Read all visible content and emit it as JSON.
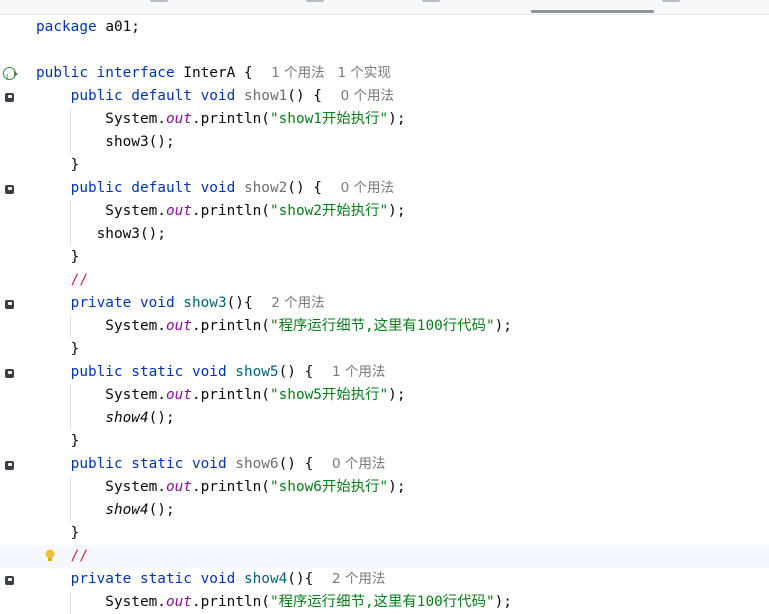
{
  "editor": {
    "lines": [
      {
        "tokens": [
          {
            "c": "kw",
            "t": "package"
          },
          {
            "c": "",
            "t": " a01;"
          }
        ]
      },
      {
        "tokens": []
      },
      {
        "gutter": "implemented",
        "tokens": [
          {
            "c": "kw",
            "t": "public interface"
          },
          {
            "c": "",
            "t": " InterA { "
          },
          {
            "c": "hint",
            "t": "1 个用法   1 个实现"
          }
        ]
      },
      {
        "gutter": "method",
        "tokens": [
          {
            "c": "",
            "t": "    "
          },
          {
            "c": "kw",
            "t": "public default void"
          },
          {
            "c": "",
            "t": " "
          },
          {
            "c": "fn-unused",
            "t": "show1"
          },
          {
            "c": "",
            "t": "() { "
          },
          {
            "c": "hint",
            "t": "0 个用法"
          }
        ]
      },
      {
        "tokens": [
          {
            "c": "",
            "t": "        System."
          },
          {
            "c": "field",
            "t": "out"
          },
          {
            "c": "",
            "t": ".println("
          },
          {
            "c": "str",
            "t": "\"show1开始执行\""
          },
          {
            "c": "",
            "t": ");"
          }
        ]
      },
      {
        "tokens": [
          {
            "c": "",
            "t": "        show3();"
          }
        ]
      },
      {
        "tokens": [
          {
            "c": "",
            "t": "    }"
          }
        ]
      },
      {
        "gutter": "method",
        "tokens": [
          {
            "c": "",
            "t": "    "
          },
          {
            "c": "kw",
            "t": "public default void"
          },
          {
            "c": "",
            "t": " "
          },
          {
            "c": "fn-unused",
            "t": "show2"
          },
          {
            "c": "",
            "t": "() { "
          },
          {
            "c": "hint",
            "t": "0 个用法"
          }
        ]
      },
      {
        "tokens": [
          {
            "c": "",
            "t": "        System."
          },
          {
            "c": "field",
            "t": "out"
          },
          {
            "c": "",
            "t": ".println("
          },
          {
            "c": "str",
            "t": "\"show2开始执行\""
          },
          {
            "c": "",
            "t": ");"
          }
        ]
      },
      {
        "tokens": [
          {
            "c": "",
            "t": "       show3();"
          }
        ]
      },
      {
        "tokens": [
          {
            "c": "",
            "t": "    }"
          }
        ]
      },
      {
        "tokens": [
          {
            "c": "",
            "t": "    "
          },
          {
            "c": "cmt-todo",
            "t": "//"
          }
        ]
      },
      {
        "gutter": "method",
        "tokens": [
          {
            "c": "",
            "t": "    "
          },
          {
            "c": "kw",
            "t": "private void"
          },
          {
            "c": "",
            "t": " "
          },
          {
            "c": "fn",
            "t": "show3"
          },
          {
            "c": "",
            "t": "(){ "
          },
          {
            "c": "hint",
            "t": "2 个用法"
          }
        ]
      },
      {
        "tokens": [
          {
            "c": "",
            "t": "        System."
          },
          {
            "c": "field",
            "t": "out"
          },
          {
            "c": "",
            "t": ".println("
          },
          {
            "c": "str",
            "t": "\"程序运行细节,这里有100行代码\""
          },
          {
            "c": "",
            "t": ");"
          }
        ]
      },
      {
        "tokens": [
          {
            "c": "",
            "t": "    }"
          }
        ]
      },
      {
        "gutter": "method",
        "tokens": [
          {
            "c": "",
            "t": "    "
          },
          {
            "c": "kw",
            "t": "public static void"
          },
          {
            "c": "",
            "t": " "
          },
          {
            "c": "fn",
            "t": "show5"
          },
          {
            "c": "",
            "t": "() { "
          },
          {
            "c": "hint",
            "t": "1 个用法"
          }
        ]
      },
      {
        "tokens": [
          {
            "c": "",
            "t": "        System."
          },
          {
            "c": "field",
            "t": "out"
          },
          {
            "c": "",
            "t": ".println("
          },
          {
            "c": "str",
            "t": "\"show5开始执行\""
          },
          {
            "c": "",
            "t": ");"
          }
        ]
      },
      {
        "tokens": [
          {
            "c": "",
            "t": "        "
          },
          {
            "c": "ital",
            "t": "show4"
          },
          {
            "c": "",
            "t": "();"
          }
        ]
      },
      {
        "tokens": [
          {
            "c": "",
            "t": "    }"
          }
        ]
      },
      {
        "gutter": "method",
        "tokens": [
          {
            "c": "",
            "t": "    "
          },
          {
            "c": "kw",
            "t": "public static void"
          },
          {
            "c": "",
            "t": " "
          },
          {
            "c": "fn-unused",
            "t": "show6"
          },
          {
            "c": "",
            "t": "() { "
          },
          {
            "c": "hint",
            "t": "0 个用法"
          }
        ]
      },
      {
        "tokens": [
          {
            "c": "",
            "t": "        System."
          },
          {
            "c": "field",
            "t": "out"
          },
          {
            "c": "",
            "t": ".println("
          },
          {
            "c": "str",
            "t": "\"show6开始执行\""
          },
          {
            "c": "",
            "t": ");"
          }
        ]
      },
      {
        "tokens": [
          {
            "c": "",
            "t": "        "
          },
          {
            "c": "ital",
            "t": "show4"
          },
          {
            "c": "",
            "t": "();"
          }
        ]
      },
      {
        "tokens": [
          {
            "c": "",
            "t": "    }"
          }
        ]
      },
      {
        "gutter": "bulb",
        "current": true,
        "tokens": [
          {
            "c": "",
            "t": "    "
          },
          {
            "c": "cmt-todo",
            "t": "//"
          }
        ]
      },
      {
        "gutter": "method",
        "tokens": [
          {
            "c": "",
            "t": "    "
          },
          {
            "c": "kw",
            "t": "private static void"
          },
          {
            "c": "",
            "t": " "
          },
          {
            "c": "fn",
            "t": "show4"
          },
          {
            "c": "",
            "t": "(){ "
          },
          {
            "c": "hint",
            "t": "2 个用法"
          }
        ]
      },
      {
        "tokens": [
          {
            "c": "",
            "t": "        System."
          },
          {
            "c": "field",
            "t": "out"
          },
          {
            "c": "",
            "t": ".println("
          },
          {
            "c": "str",
            "t": "\"程序运行细节,这里有100行代码\""
          },
          {
            "c": "",
            "t": ");"
          }
        ]
      }
    ]
  }
}
